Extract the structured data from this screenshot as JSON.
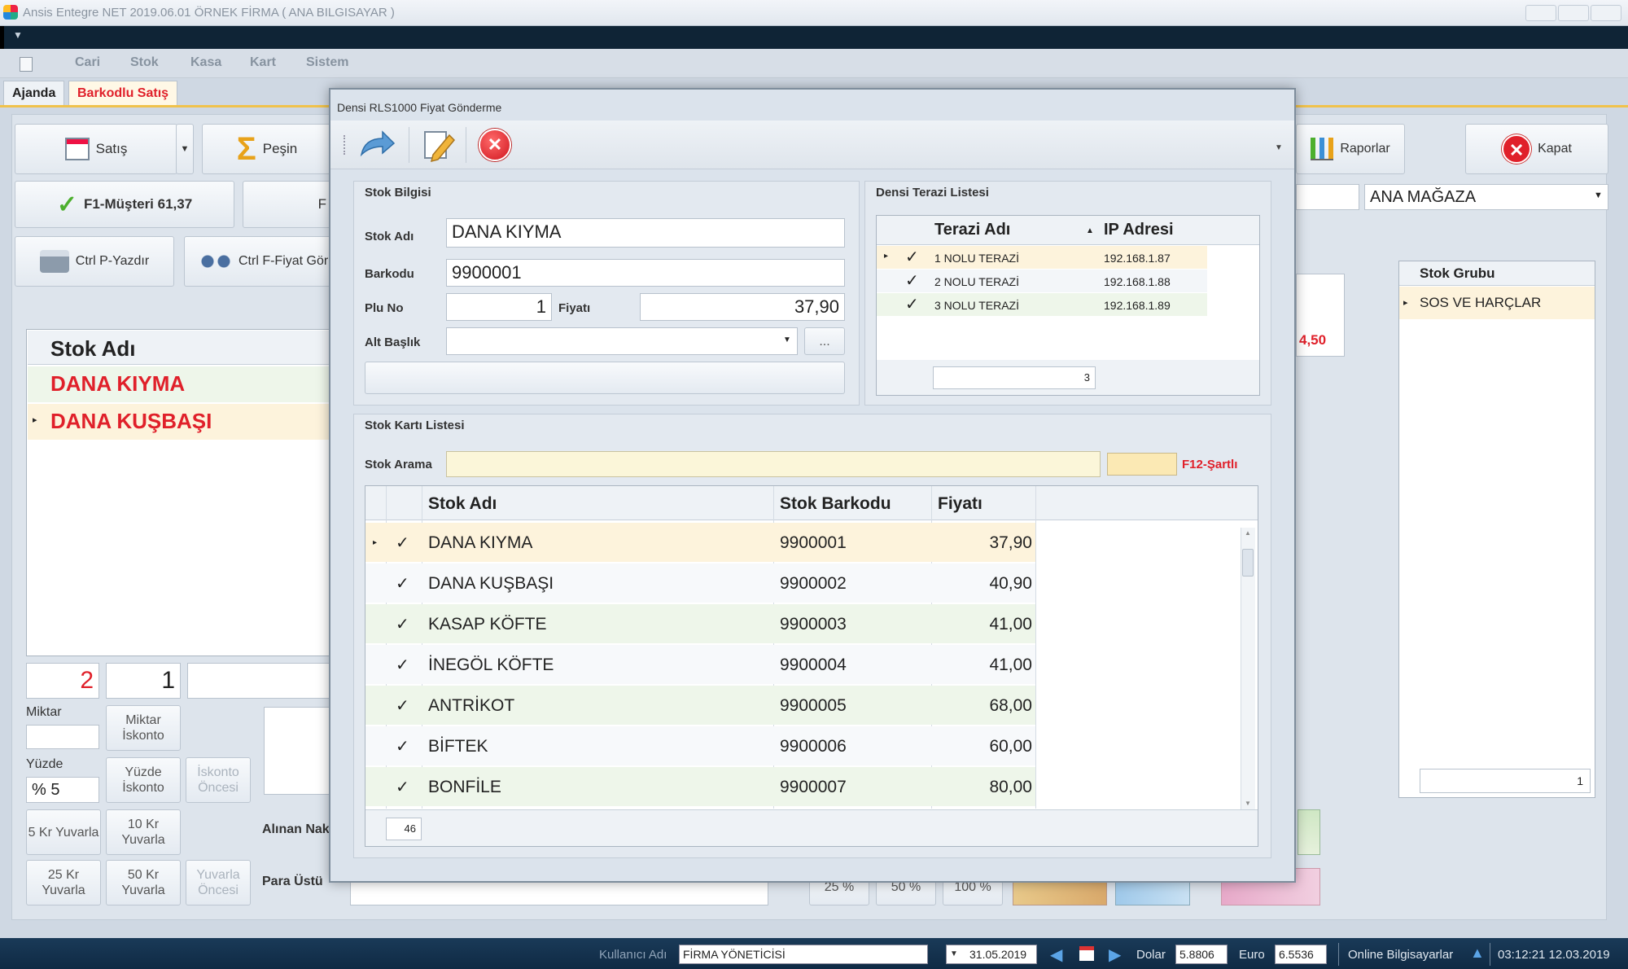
{
  "window": {
    "title": "Ansis Entegre NET 2019.06.01 ÖRNEK FİRMA ( ANA BILGISAYAR )"
  },
  "menu": [
    "Cari",
    "Stok",
    "Kasa",
    "Kart",
    "Sistem"
  ],
  "tabs": [
    "Ajanda",
    "Barkodlu Satış"
  ],
  "toolbar": {
    "satis": "Satış",
    "pesin": "Peşin",
    "musteri": "F1-Müşteri 61,37",
    "f_partial": "F",
    "print": "Ctrl P-Yazdır",
    "price": "Ctrl F-Fiyat Gör",
    "reports": "Raporlar",
    "close": "Kapat"
  },
  "store": {
    "value": "ANA MAĞAZA"
  },
  "left_grid": {
    "header": "Stok Adı",
    "rows": [
      "DANA KIYMA",
      "DANA KUŞBAŞI"
    ]
  },
  "qty": {
    "value1": "2",
    "value2": "1",
    "miktar_label": "Miktar",
    "yuzde_label": "Yüzde",
    "yuzde_value": "% 5"
  },
  "discount_buttons": {
    "miktar_iskonto": "Miktar İskonto",
    "yuzde_iskonto": "Yüzde İskonto",
    "iskonto_oncesi": "İskonto Öncesi",
    "kr5": "5 Kr Yuvarla",
    "kr10": "10 Kr Yuvarla",
    "kr25": "25 Kr Yuvarla",
    "kr50": "50 Kr Yuvarla",
    "yuvarla_oncesi": "Yuvarla Öncesi"
  },
  "payment": {
    "alinan": "Alınan Nak",
    "para_ustu": "Para Üstü",
    "amount_partial": "4,50"
  },
  "money": {
    "p25": "25 %",
    "p50": "50 %",
    "p100": "100 %"
  },
  "stock_group": {
    "header": "Stok Grubu",
    "rows": [
      "SOS VE HARÇLAR"
    ],
    "count": "1"
  },
  "dialog": {
    "title": "Densi RLS1000 Fiyat Gönderme",
    "stock_info": {
      "header": "Stok Bilgisi",
      "stok_adi_label": "Stok Adı",
      "stok_adi": "DANA KIYMA",
      "barkod_label": "Barkodu",
      "barkod": "9900001",
      "plu_label": "Plu No",
      "plu": "1",
      "fiyat_label": "Fiyatı",
      "fiyat": "37,90",
      "alt_baslik_label": "Alt Başlık",
      "alt_baslik": "",
      "ellipsis": "..."
    },
    "scales": {
      "header": "Densi Terazi Listesi",
      "col_name": "Terazi Adı",
      "col_ip": "IP Adresi",
      "rows": [
        {
          "name": "1 NOLU TERAZİ",
          "ip": "192.168.1.87"
        },
        {
          "name": "2 NOLU TERAZİ",
          "ip": "192.168.1.88"
        },
        {
          "name": "3 NOLU TERAZİ",
          "ip": "192.168.1.89"
        }
      ],
      "count": "3"
    },
    "stock_list": {
      "header": "Stok Kartı Listesi",
      "search_label": "Stok Arama",
      "search_value": "",
      "f12": "F12-Şartlı",
      "col_name": "Stok Adı",
      "col_barcode": "Stok Barkodu",
      "col_price": "Fiyatı",
      "rows": [
        {
          "name": "DANA KIYMA",
          "barcode": "9900001",
          "price": "37,90"
        },
        {
          "name": "DANA KUŞBAŞI",
          "barcode": "9900002",
          "price": "40,90"
        },
        {
          "name": "KASAP KÖFTE",
          "barcode": "9900003",
          "price": "41,00"
        },
        {
          "name": "İNEGÖL KÖFTE",
          "barcode": "9900004",
          "price": "41,00"
        },
        {
          "name": "ANTRİKOT",
          "barcode": "9900005",
          "price": "68,00"
        },
        {
          "name": "BİFTEK",
          "barcode": "9900006",
          "price": "60,00"
        },
        {
          "name": "BONFİLE",
          "barcode": "9900007",
          "price": "80,00"
        }
      ],
      "count": "46"
    }
  },
  "status": {
    "user_label": "Kullanıcı Adı",
    "user": "FİRMA YÖNETİCİSİ",
    "date": "31.05.2019",
    "dolar_label": "Dolar",
    "dolar": "5.8806",
    "euro_label": "Euro",
    "euro": "6.5536",
    "online": "Online Bilgisayarlar",
    "datetime": "03:12:21 12.03.2019"
  },
  "colors": {
    "red": "#e0202a",
    "accent": "#f0c24b",
    "row_selected": "#fdf3dc",
    "row_green": "#eef6ea"
  }
}
